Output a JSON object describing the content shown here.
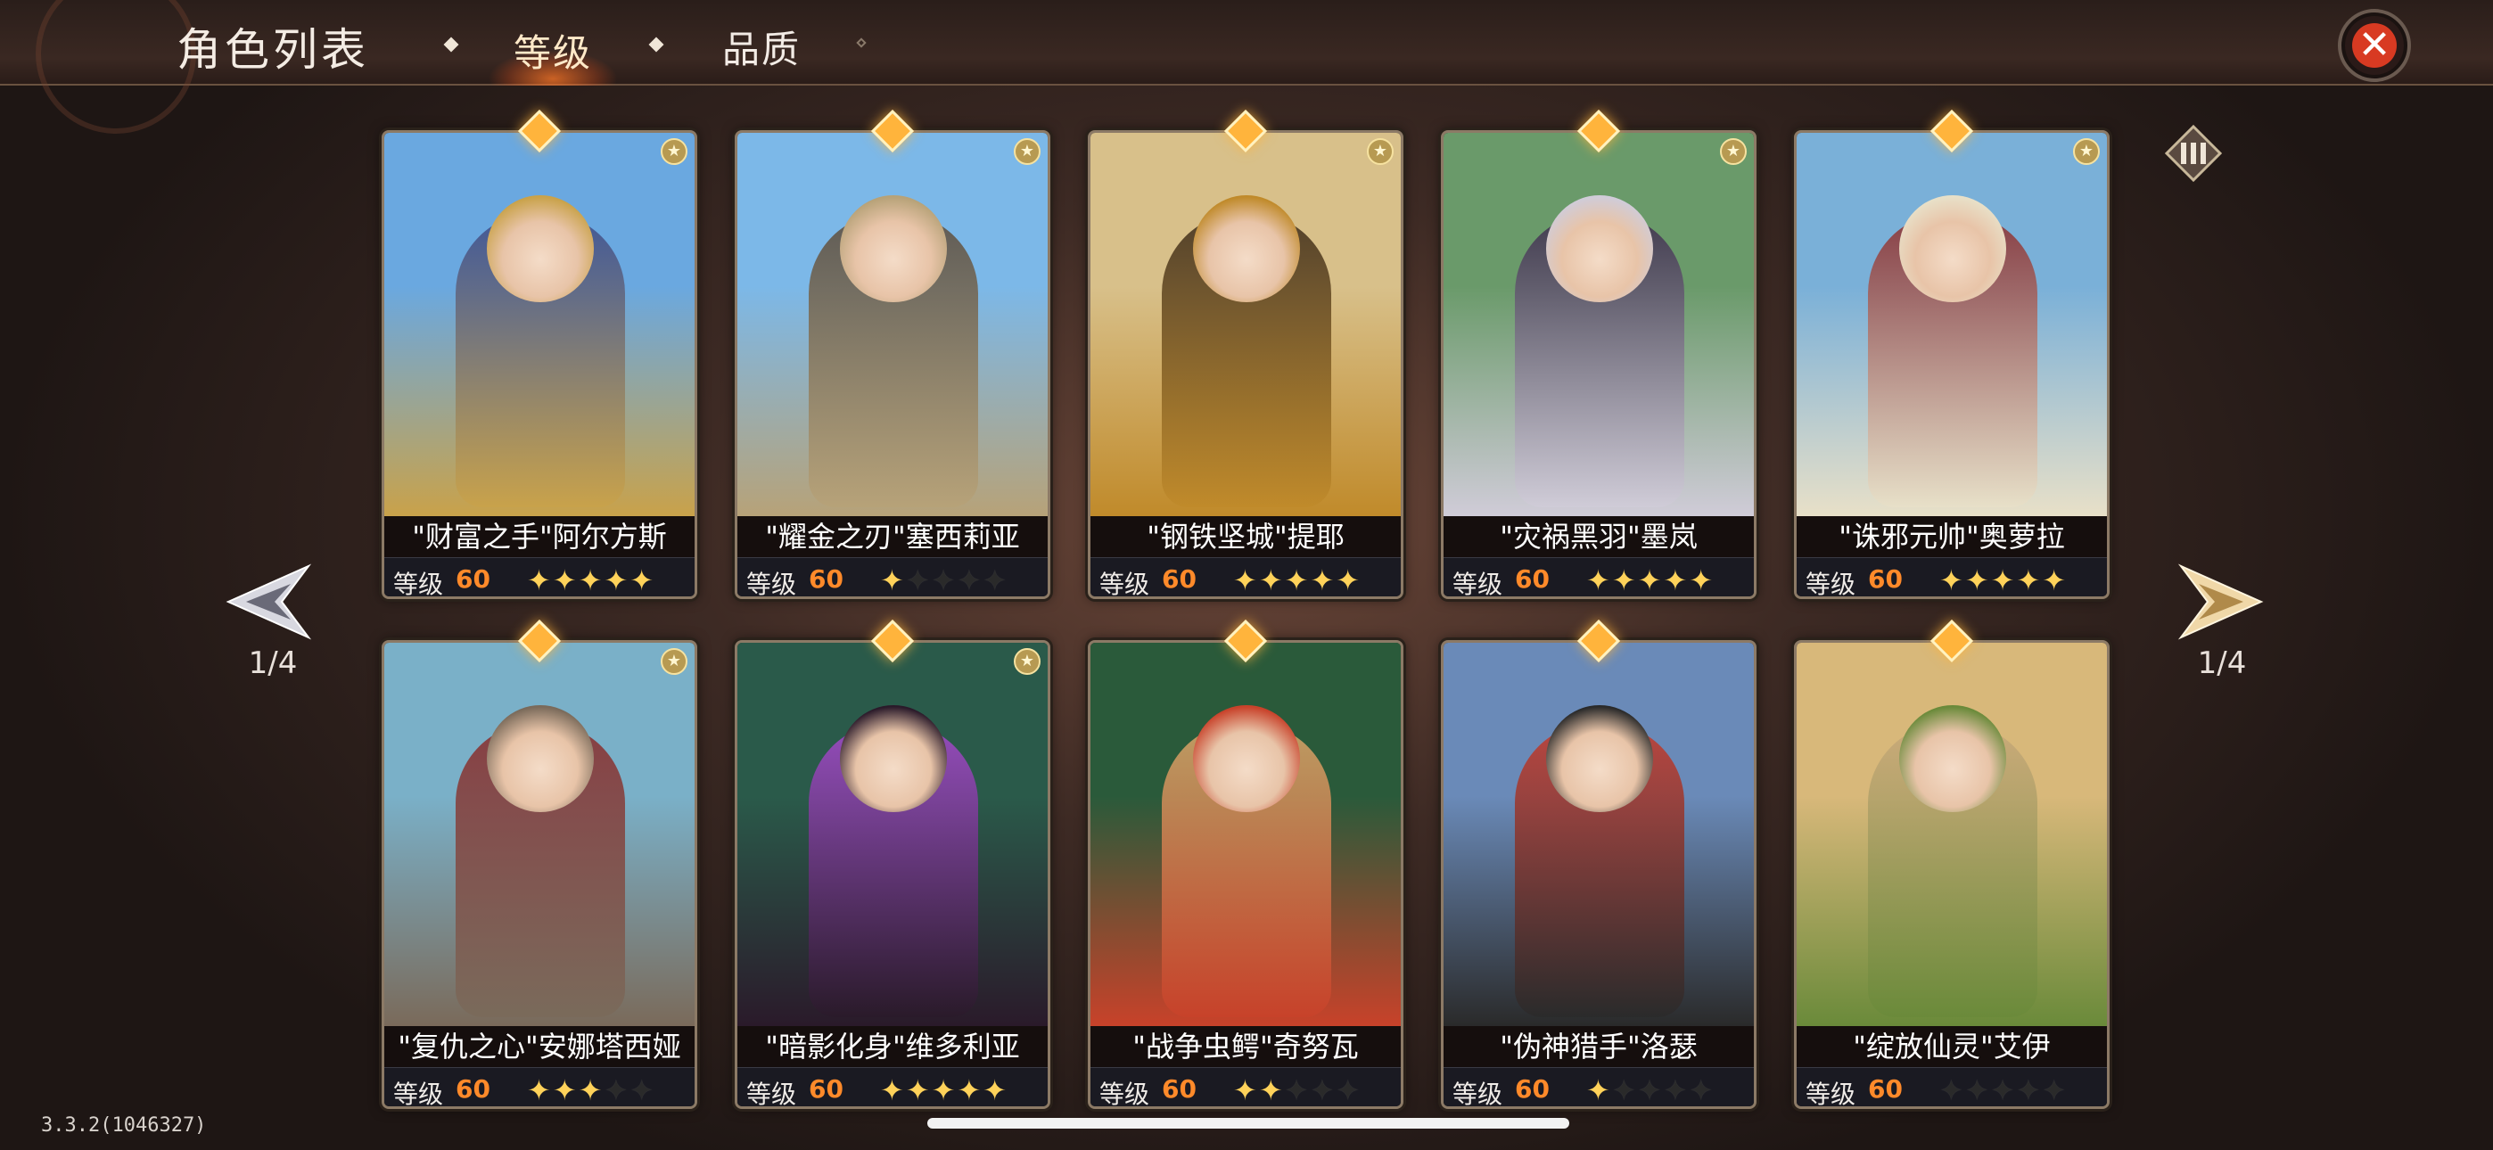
{
  "header": {
    "title": "角色列表",
    "tabs": [
      {
        "label": "等级",
        "active": true
      },
      {
        "label": "品质",
        "active": false
      }
    ]
  },
  "pagination": {
    "left": "1/4",
    "right": "1/4"
  },
  "level_label": "等级",
  "version": "3.3.2(1046327)",
  "colors": {
    "accent": "#ff8a2a",
    "star": "#ffd25a",
    "close": "#d83a22"
  },
  "cards": [
    {
      "name": "\"财富之手\"阿尔方斯",
      "level": "60",
      "stars_filled": 5,
      "stars_total": 5,
      "badge": true,
      "art": [
        "#6aa8e0",
        "#c9a24a",
        "#3a4a8a"
      ]
    },
    {
      "name": "\"耀金之刃\"塞西莉亚",
      "level": "60",
      "stars_filled": 1,
      "stars_total": 5,
      "badge": true,
      "art": [
        "#7cb8e8",
        "#b7a278",
        "#5a4a3a"
      ]
    },
    {
      "name": "\"钢铁坚城\"提耶",
      "level": "60",
      "stars_filled": 5,
      "stars_total": 5,
      "badge": true,
      "art": [
        "#d8c08a",
        "#c08a2a",
        "#3a2a1a"
      ]
    },
    {
      "name": "\"灾祸黑羽\"墨岚",
      "level": "60",
      "stars_filled": 5,
      "stars_total": 5,
      "badge": true,
      "art": [
        "#6a9a6a",
        "#d0ccd8",
        "#3a2a4a"
      ]
    },
    {
      "name": "\"诛邪元帅\"奥萝拉",
      "level": "60",
      "stars_filled": 5,
      "stars_total": 5,
      "badge": true,
      "art": [
        "#7ab0d8",
        "#e8e0c8",
        "#8a2a2a"
      ]
    },
    {
      "name": "\"复仇之心\"安娜塔西娅",
      "level": "60",
      "stars_filled": 3,
      "stars_total": 5,
      "badge": true,
      "art": [
        "#7ab0c8",
        "#7a6a5a",
        "#8a2a2a"
      ]
    },
    {
      "name": "\"暗影化身\"维多利亚",
      "level": "60",
      "stars_filled": 5,
      "stars_total": 5,
      "badge": true,
      "art": [
        "#2a5a4a",
        "#2a1a2a",
        "#a84ad0"
      ]
    },
    {
      "name": "\"战争虫鳄\"奇努瓦",
      "level": "60",
      "stars_filled": 2,
      "stars_total": 5,
      "badge": false,
      "art": [
        "#2a5a3a",
        "#c8422a",
        "#d8a86a"
      ]
    },
    {
      "name": "\"伪神猎手\"洛瑟",
      "level": "60",
      "stars_filled": 1,
      "stars_total": 5,
      "badge": false,
      "art": [
        "#6a8ab8",
        "#2a2a2a",
        "#c83a2a"
      ]
    },
    {
      "name": "\"绽放仙灵\"艾伊",
      "level": "60",
      "stars_filled": 0,
      "stars_total": 5,
      "badge": false,
      "art": [
        "#d8b87a",
        "#6a8a3a",
        "#c8a87a"
      ]
    }
  ]
}
